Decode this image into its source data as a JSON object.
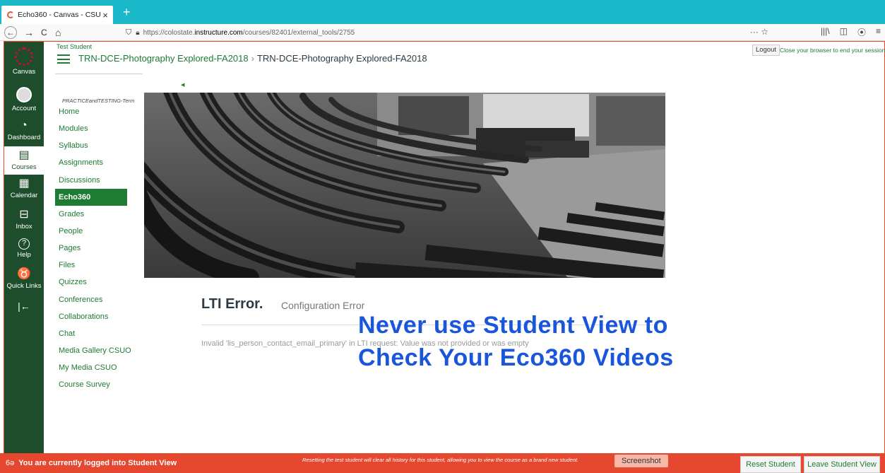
{
  "browser": {
    "tab_title": "Echo360 - Canvas - CSU",
    "tab_close": "×",
    "new_tab": "+",
    "back": "←",
    "forward": "→",
    "reload": "C",
    "home": "⌂",
    "url_prefix": "https://colostate.",
    "url_domain": "instructure.com",
    "url_path": "/courses/82401/external_tools/2755",
    "url_actions": "··· ☆",
    "tools": [
      "|||\\",
      "◫",
      "⦿",
      "≡"
    ]
  },
  "global_nav": {
    "items": [
      {
        "label": "Canvas",
        "icon": "canvas-logo"
      },
      {
        "label": "Account",
        "icon": "avatar"
      },
      {
        "label": "Dashboard",
        "icon": "dashboard-icon",
        "glyph": "◔"
      },
      {
        "label": "Courses",
        "icon": "book-icon",
        "glyph": "▤"
      },
      {
        "label": "Calendar",
        "icon": "calendar-icon",
        "glyph": "▦"
      },
      {
        "label": "Inbox",
        "icon": "inbox-icon",
        "glyph": "⊟"
      },
      {
        "label": "Help",
        "icon": "help-icon",
        "glyph": "?"
      },
      {
        "label": "Quick Links",
        "icon": "ram-icon",
        "glyph": "♉"
      }
    ],
    "collapse_glyph": "|←"
  },
  "header": {
    "user": "Test Student",
    "breadcrumb": [
      "TRN-DCE-Photography Explored-FA2018",
      "TRN-DCE-Photography Explored-FA2018"
    ],
    "breadcrumb_sep": "›",
    "logout_label": "Logout",
    "logout_note": "Close your browser to end your session."
  },
  "course_nav": {
    "term": "PRACTICEandTESTING-Term",
    "items": [
      "Home",
      "Modules",
      "Syllabus",
      "Assignments",
      "Discussions",
      "Echo360",
      "Grades",
      "People",
      "Pages",
      "Files",
      "Quizzes",
      "Conferences",
      "Collaborations",
      "Chat",
      "Media Gallery CSUO",
      "My Media CSUO",
      "Course Survey"
    ],
    "active": "Echo360"
  },
  "content": {
    "error_title": "LTI Error.",
    "error_subtitle": "Configuration Error",
    "error_message": "Invalid 'lis_person_contact_email_primary' in LTI request: Value was not provided or was empty",
    "overlay_line1": "Never use Student View to",
    "overlay_line2": "Check Your Eco360 Videos"
  },
  "footer": {
    "icon": "6ə",
    "status": "You are currently logged into Student View",
    "note": "Resetting the test student will clear all history for this student, allowing you to view the course as a brand new student.",
    "screenshot_label": "Screenshot",
    "reset_label": "Reset Student",
    "leave_label": "Leave Student View"
  },
  "colors": {
    "teal_tabbar": "#1bb8c9",
    "csu_green": "#1e4d2b",
    "link_green": "#1e7b34",
    "student_view_red": "#e5472f",
    "overlay_blue": "#1a56db"
  }
}
